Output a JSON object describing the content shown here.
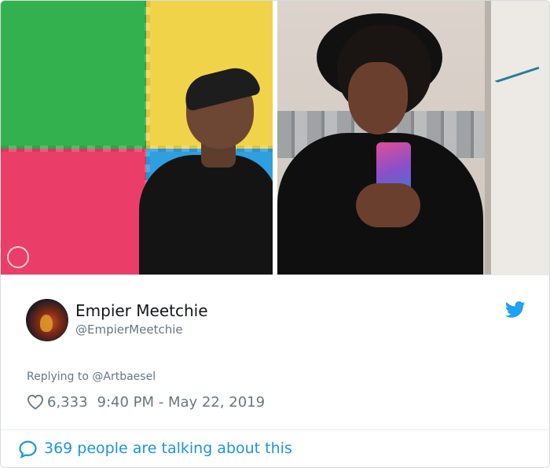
{
  "tweet": {
    "author_name": "Empier Meetchie",
    "author_handle": "@EmpierMeetchie",
    "reply_prefix": "Replying to",
    "reply_mention": "@Artbaesel",
    "likes": "6,333",
    "timestamp": "9:40 PM - May 22, 2019",
    "talking": "369 people are talking about this"
  },
  "colors": {
    "twitter_blue": "#1b95e0",
    "secondary_text": "#657786",
    "primary_text": "#14171a"
  },
  "icons": {
    "brand": "twitter-bird-icon",
    "like": "heart-outline-icon",
    "conversation": "speech-bubble-icon"
  }
}
